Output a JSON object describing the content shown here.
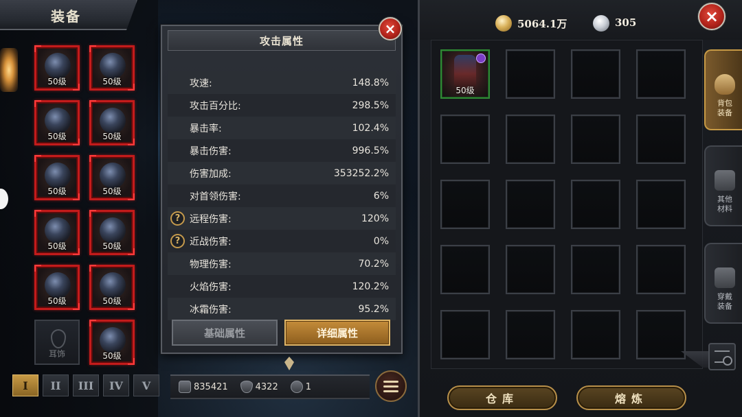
{
  "left_panel": {
    "title": "装备",
    "slots": [
      {
        "level": "50级"
      },
      {
        "level": "50级"
      },
      {
        "level": "50级"
      },
      {
        "level": "50级"
      },
      {
        "level": "50级"
      },
      {
        "level": "50级"
      },
      {
        "level": "50级"
      },
      {
        "level": "50级"
      },
      {
        "level": "50级"
      },
      {
        "level": "50级"
      },
      {
        "empty": true,
        "label": "耳饰"
      },
      {
        "level": "50级"
      }
    ],
    "page_tabs": [
      "I",
      "II",
      "III",
      "IV",
      "V"
    ],
    "active_page": "I"
  },
  "stats_popup": {
    "title": "攻击属性",
    "rows": [
      {
        "name": "攻速:",
        "value": "148.8%",
        "help": false
      },
      {
        "name": "攻击百分比:",
        "value": "298.5%",
        "help": false
      },
      {
        "name": "暴击率:",
        "value": "102.4%",
        "help": false
      },
      {
        "name": "暴击伤害:",
        "value": "996.5%",
        "help": false
      },
      {
        "name": "伤害加成:",
        "value": "353252.2%",
        "help": false
      },
      {
        "name": "对首领伤害:",
        "value": "6%",
        "help": false
      },
      {
        "name": "远程伤害:",
        "value": "120%",
        "help": true
      },
      {
        "name": "近战伤害:",
        "value": "0%",
        "help": true
      },
      {
        "name": "物理伤害:",
        "value": "70.2%",
        "help": false
      },
      {
        "name": "火焰伤害:",
        "value": "120.2%",
        "help": false
      },
      {
        "name": "冰霜伤害:",
        "value": "95.2%",
        "help": false
      }
    ],
    "tabs": {
      "basic": "基础属性",
      "detail": "详细属性"
    },
    "active_tab": "detail",
    "help_glyph": "?",
    "close_glyph": "×"
  },
  "player_stats": {
    "power": "835421",
    "defense": "4322",
    "hp": "1"
  },
  "currency": {
    "gold": "5064.1万",
    "silver": "305"
  },
  "inventory": {
    "items": [
      {
        "level": "50级",
        "filled": true
      }
    ],
    "cell_count": 20,
    "side_tabs": [
      "背包装备",
      "其他材料",
      "穿戴装备"
    ],
    "active_side_tab": "背包装备",
    "buttons": {
      "warehouse": "仓库",
      "smelt": "熔炼"
    },
    "close_glyph": "×"
  },
  "colors": {
    "equip_border": "#c31b1b",
    "active_gold": "#c79a45",
    "inventory_filled_border": "#2f8a34",
    "close_red": "#b3241b"
  },
  "icons": {
    "gold": "gold-coin-icon",
    "silver": "diamond-icon",
    "power": "crossed-swords-icon",
    "defense": "shield-icon",
    "hp": "heart-icon",
    "menu": "list-menu-icon",
    "search": "search-list-icon"
  }
}
